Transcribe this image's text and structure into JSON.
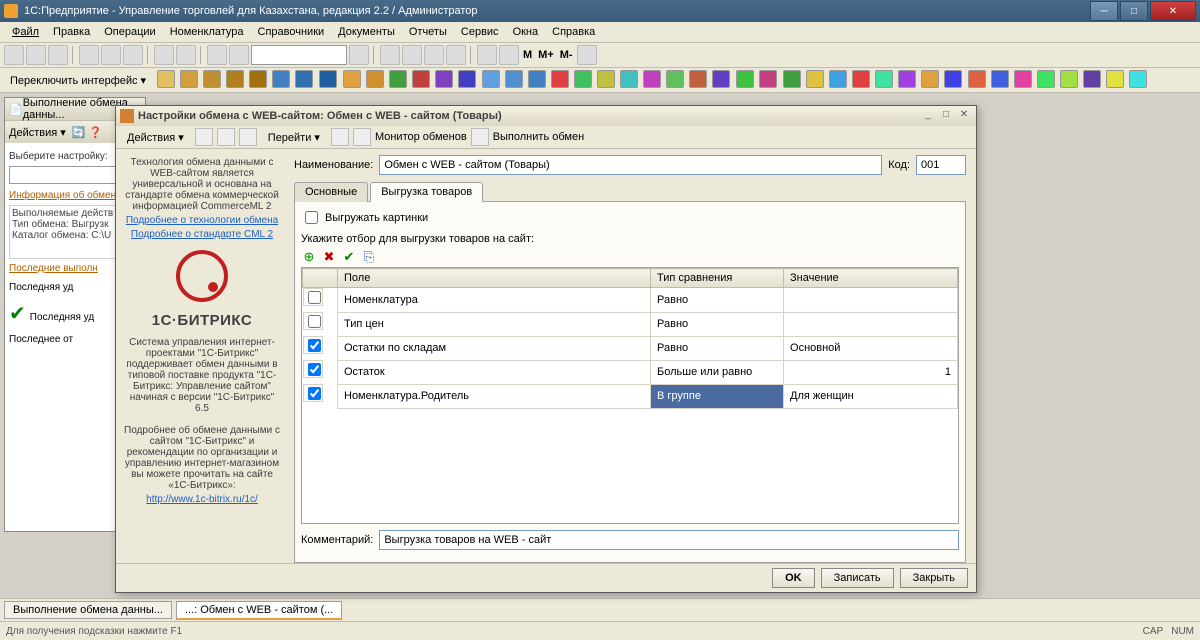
{
  "app": {
    "title": "1С:Предприятие - Управление торговлей для Казахстана, редакция 2.2 / Администратор"
  },
  "menu": [
    "Файл",
    "Правка",
    "Операции",
    "Номенклатура",
    "Справочники",
    "Документы",
    "Отчеты",
    "Сервис",
    "Окна",
    "Справка"
  ],
  "switch_label": "Переключить интерфейс ▾",
  "bgwin": {
    "title": "Выполнение обмена данны...",
    "actions": "Действия ▾",
    "choose": "Выберите настройку:",
    "info": "Информация об обмене",
    "l1": "Выполняемые действ",
    "l2": "Тип обмена: Выгрузк",
    "l3": "Каталог обмена: C:\\U",
    "last_head": "Последние выполн",
    "last1": "Последняя уд",
    "last2": "Последняя уд",
    "last3": "Последнее от"
  },
  "dialog": {
    "title": "Настройки обмена с WEB-сайтом: Обмен с WEB - сайтом (Товары)",
    "toolbar": {
      "actions": "Действия ▾",
      "goto": "Перейти ▾",
      "mon": "Монитор обменов",
      "run": "Выполнить обмен"
    },
    "side": {
      "p1": "Технология обмена данными с WEB-сайтом является универсальной и основана на стандарте обмена коммерческой информацией CommerceML 2",
      "a1": "Подробнее о технологии обмена",
      "a2": "Подробнее о стандарте CML 2",
      "brand": "1С·БИТРИКС",
      "p2": "Система управления интернет-проектами \"1С-Битрикс\" поддерживает обмен данными в типовой поставке продукта \"1С-Битрикс: Управление сайтом\" начиная с версии \"1С-Битрикс\" 6.5",
      "p3": "Подробнее об обмене данными с сайтом \"1С-Битрикс\" и рекомендации по организации и управлению интернет-магазином вы можете прочитать на сайте «1С-Битрикс»:",
      "a3": "http://www.1c-bitrix.ru/1c/"
    },
    "name_lbl": "Наименование:",
    "name_val": "Обмен с WEB - сайтом (Товары)",
    "code_lbl": "Код:",
    "code_val": "001",
    "tabs": [
      "Основные",
      "Выгрузка товаров"
    ],
    "chk_pic": "Выгружать картинки",
    "hint": "Укажите отбор для выгрузки товаров на сайт:",
    "cols": [
      "",
      "Поле",
      "Тип сравнения",
      "Значение"
    ],
    "rows": [
      {
        "c": false,
        "f": "Номенклатура",
        "t": "Равно",
        "v": ""
      },
      {
        "c": false,
        "f": "Тип цен",
        "t": "Равно",
        "v": ""
      },
      {
        "c": true,
        "f": "Остатки по складам",
        "t": "Равно",
        "v": "Основной"
      },
      {
        "c": true,
        "f": "Остаток",
        "t": "Больше или равно",
        "v": "1",
        "r": true
      },
      {
        "c": true,
        "f": "Номенклатура.Родитель",
        "t": "В группе",
        "v": "Для женщин",
        "sel": true
      }
    ],
    "comm_lbl": "Комментарий:",
    "comm_val": "Выгрузка товаров на WEB - сайт",
    "btns": {
      "ok": "OK",
      "save": "Записать",
      "close": "Закрыть"
    }
  },
  "tasks": [
    "Выполнение обмена данны...",
    "...: Обмен с WEB - сайтом (..."
  ],
  "status": {
    "hint": "Для получения подсказки нажмите F1",
    "cap": "CAP",
    "num": "NUM"
  }
}
